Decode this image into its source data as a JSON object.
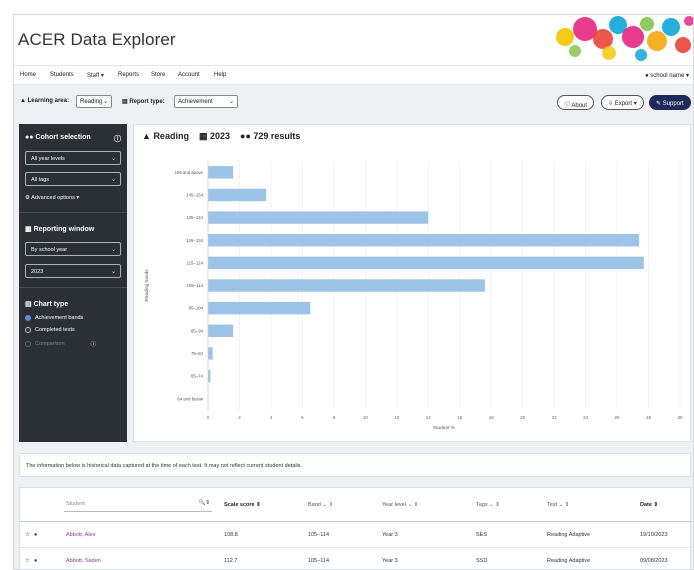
{
  "app": {
    "title": "ACER Data Explorer"
  },
  "nav": {
    "items": [
      "Home",
      "Students",
      "Staff ▾",
      "Reports",
      "Store",
      "Account",
      "Help"
    ],
    "user": "school name ▾"
  },
  "toolbar": {
    "learning_area_label": "Learning area:",
    "learning_area_value": "Reading",
    "report_type_label": "Report type:",
    "report_type_value": "Achievement",
    "about_label": "About",
    "export_label": "Export ▾",
    "support_label": "Support"
  },
  "sidebar": {
    "cohort_heading": "Cohort selection",
    "year_levels": "All year levels",
    "tags": "All tags",
    "advanced": "Advanced options ▾",
    "reporting_heading": "Reporting window",
    "window_type": "By school year",
    "year": "2023",
    "chart_type_heading": "Chart type",
    "chart_types": [
      {
        "label": "Achievement bands",
        "selected": true,
        "disabled": false
      },
      {
        "label": "Completed tests",
        "selected": false,
        "disabled": false
      },
      {
        "label": "Comparison",
        "selected": false,
        "disabled": true
      }
    ]
  },
  "chart_header": {
    "subject": "Reading",
    "year": "2023",
    "results": "729 results"
  },
  "chart_data": {
    "type": "bar",
    "orientation": "horizontal",
    "categories": [
      "155 and above",
      "145–154",
      "135–144",
      "125–134",
      "115–124",
      "105–114",
      "95–104",
      "85–94",
      "75–84",
      "65–74",
      "64 and below"
    ],
    "values": [
      1.6,
      3.7,
      14,
      27.4,
      27.7,
      17.6,
      6.5,
      1.6,
      0.3,
      0.15,
      0
    ],
    "xlabel": "Student %",
    "ylabel": "Reading bands",
    "xlim": [
      0,
      30
    ],
    "xticks": [
      0,
      2,
      4,
      6,
      8,
      10,
      12,
      14,
      16,
      18,
      20,
      22,
      24,
      26,
      28,
      30
    ],
    "bar_color": "#9ec3e8",
    "grid": true
  },
  "info": {
    "text": "The information below is historical data captured at the time of each test. It may not reflect current student details."
  },
  "table": {
    "search_placeholder": "Student",
    "headers": [
      "Scale score",
      "Band",
      "Year level",
      "Tags",
      "Test",
      "Date"
    ],
    "rows": [
      {
        "name": "Abbott, Alex",
        "score": "108.8",
        "band": "105–114",
        "year": "Year 3",
        "tags": "SES",
        "test": "Reading Adaptive",
        "date": "19/10/2023"
      },
      {
        "name": "Abbott, Saden",
        "score": "112.7",
        "band": "105–114",
        "year": "Year 3",
        "tags": "SSD",
        "test": "Reading Adaptive",
        "date": "09/08/2023"
      }
    ]
  },
  "colors": {
    "accent": "#1e2a5a",
    "sidebar": "#2b3035",
    "link": "#8a3c8f"
  }
}
